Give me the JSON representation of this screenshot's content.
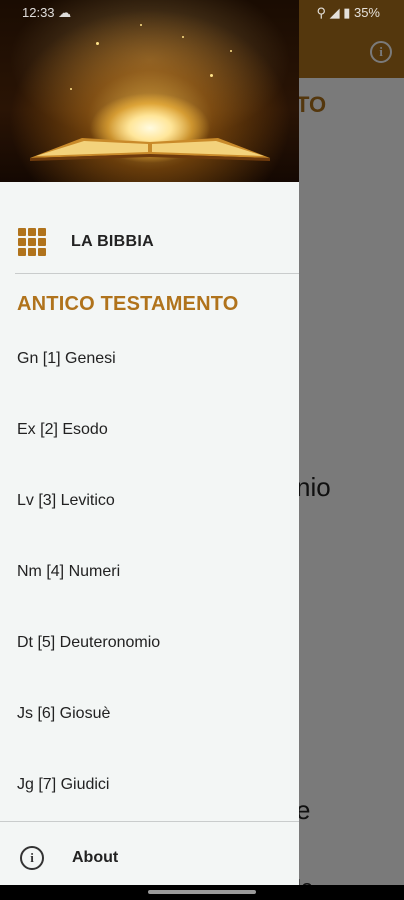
{
  "background": {
    "title_fragment": "TO",
    "word1": "nio",
    "word2": "e",
    "word3": "le",
    "accent_color": "#b0731c"
  },
  "status_bar": {
    "time": "12:33 ☁",
    "indicators": "⚲ ◢ ▮ 35%"
  },
  "drawer": {
    "header_image": "glowing-open-bible",
    "home_item": {
      "icon": "grid-icon",
      "label": "LA BIBBIA"
    },
    "section_title": "ANTICO TESTAMENTO",
    "books": [
      "Gn [1] Genesi",
      "Ex [2] Esodo",
      "Lv [3] Levitico",
      "Nm [4] Numeri",
      "Dt [5] Deuteronomio",
      "Js [6] Giosuè",
      "Jg [7] Giudici"
    ],
    "about": {
      "icon": "info-icon",
      "label": "About"
    }
  }
}
